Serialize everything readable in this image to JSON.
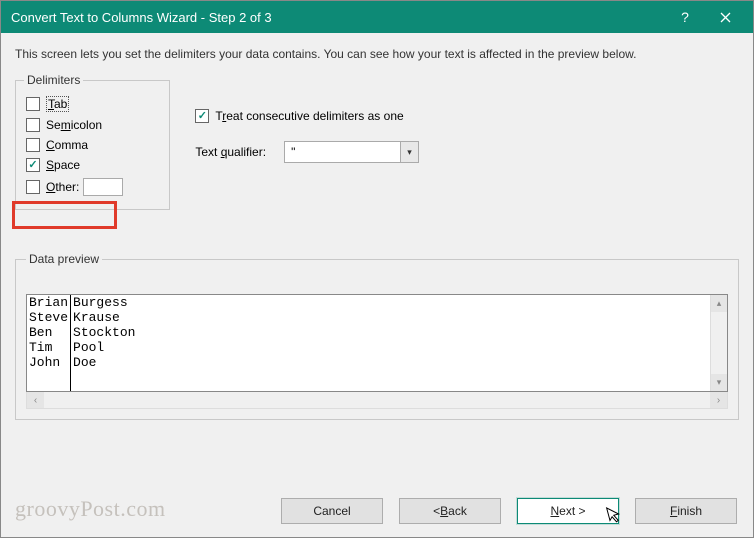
{
  "window": {
    "title": "Convert Text to Columns Wizard - Step 2 of 3"
  },
  "instruction": "This screen lets you set the delimiters your data contains.  You can see how your text is affected in the preview below.",
  "delimiters": {
    "legend": "Delimiters",
    "tab": {
      "label": "Tab",
      "underline": "T",
      "checked": false
    },
    "semicolon": {
      "label": "Semicolon",
      "underline": "m",
      "checked": false
    },
    "comma": {
      "label": "Comma",
      "underline": "C",
      "checked": false
    },
    "space": {
      "label": "Space",
      "underline": "S",
      "checked": true
    },
    "other": {
      "label": "Other:",
      "underline": "O",
      "checked": false,
      "value": ""
    }
  },
  "consecutive": {
    "label": "Treat consecutive delimiters as one",
    "underline": "r",
    "checked": true
  },
  "qualifier": {
    "label": "Text qualifier:",
    "underline": "q",
    "value": "\""
  },
  "preview": {
    "legend": "Data preview",
    "col1": [
      "Brian",
      "Steve",
      "Ben",
      "Tim",
      "John"
    ],
    "col2": [
      "Burgess",
      "Krause",
      "Stockton",
      "Pool",
      "Doe"
    ]
  },
  "buttons": {
    "cancel": "Cancel",
    "back": "< Back",
    "next": "Next >",
    "finish": "Finish"
  },
  "watermark": "groovyPost.com"
}
